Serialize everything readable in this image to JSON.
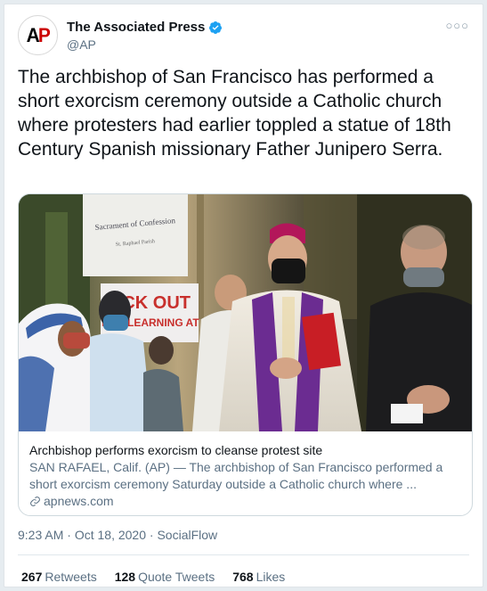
{
  "author": {
    "display_name": "The Associated Press",
    "handle": "@AP",
    "avatar_logo": "AP",
    "verified": true,
    "verified_icon": "verified-badge-icon",
    "verified_color": "#1da1f2"
  },
  "more_icon": "more-options-icon",
  "tweet": {
    "text": "The archbishop of San Francisco has performed a short exorcism ceremony outside a Catholic church where protesters had earlier toppled a statue of 18th Century Spanish missionary Father Junipero Serra."
  },
  "link_card": {
    "image_signs": {
      "sign_top": "Sacrament of Confession",
      "sign_top_sub": "St. Raphael Parish",
      "sign_bottom_line1": "ECK OUT",
      "sign_bottom_line2": "NCE LEARNING AT"
    },
    "title": "Archbishop performs exorcism to cleanse protest site",
    "description": "SAN RAFAEL, Calif. (AP) — The archbishop of San Francisco performed a short exorcism ceremony Saturday outside a Catholic church where ...",
    "domain": "apnews.com",
    "domain_icon": "link-icon"
  },
  "meta": {
    "time": "9:23 AM",
    "separator": "·",
    "date": "Oct 18, 2020",
    "source": "SocialFlow",
    "full": "9:23 AM · Oct 18, 2020 · SocialFlow"
  },
  "stats": {
    "retweets_count": "267",
    "retweets_label": "Retweets",
    "quotes_count": "128",
    "quotes_label": "Quote Tweets",
    "likes_count": "768",
    "likes_label": "Likes"
  }
}
